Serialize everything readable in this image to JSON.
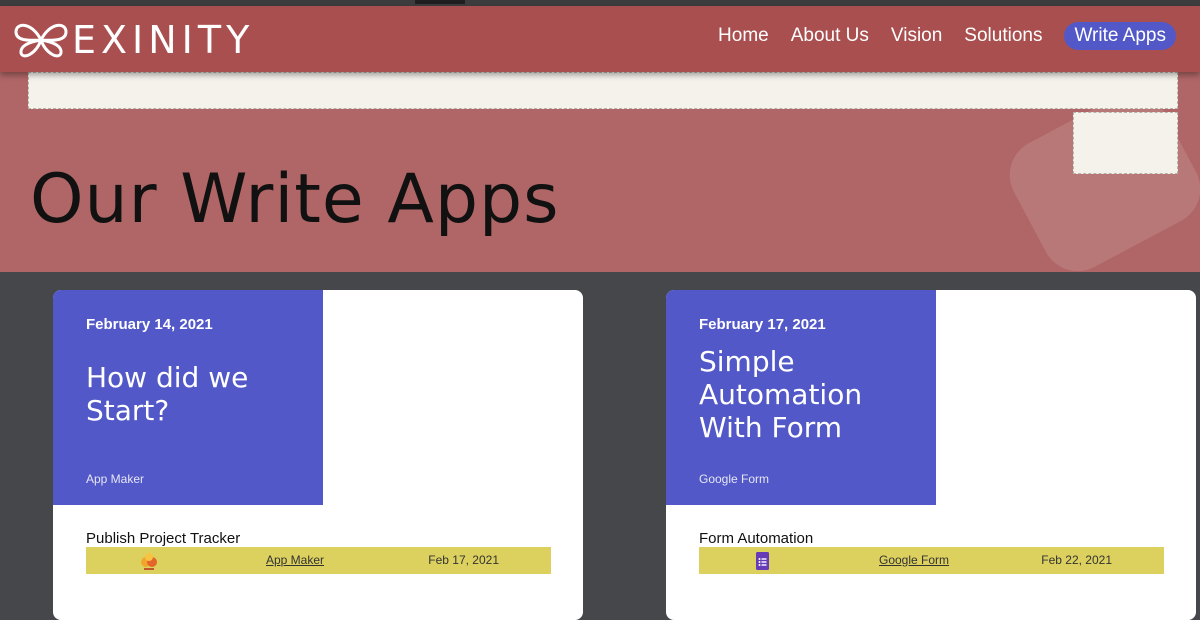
{
  "header": {
    "logo_text": "EXINITY",
    "nav": [
      {
        "label": "Home"
      },
      {
        "label": "About Us"
      },
      {
        "label": "Vision"
      },
      {
        "label": "Solutions"
      },
      {
        "label": "Write Apps",
        "active": true
      }
    ]
  },
  "hero": {
    "title": "Our Write Apps"
  },
  "cards": [
    {
      "date": "February 14, 2021",
      "title": "How did we Start?",
      "tag": "App Maker",
      "subtitle": "Publish Project Tracker",
      "bar_link": "App Maker",
      "bar_date": "Feb 17, 2021",
      "icon": "app-maker-icon"
    },
    {
      "date": "February 17, 2021",
      "title": "Simple Automation With Form",
      "tag": "Google Form",
      "subtitle": "Form Automation",
      "bar_link": "Google Form",
      "bar_date": "Feb 22, 2021",
      "icon": "google-form-icon"
    }
  ],
  "colors": {
    "header_bg": "#a94f4f",
    "hero_bg": "#b06666",
    "accent": "#5258c7",
    "bar": "#dcd15f",
    "page_bg": "#45474a"
  }
}
